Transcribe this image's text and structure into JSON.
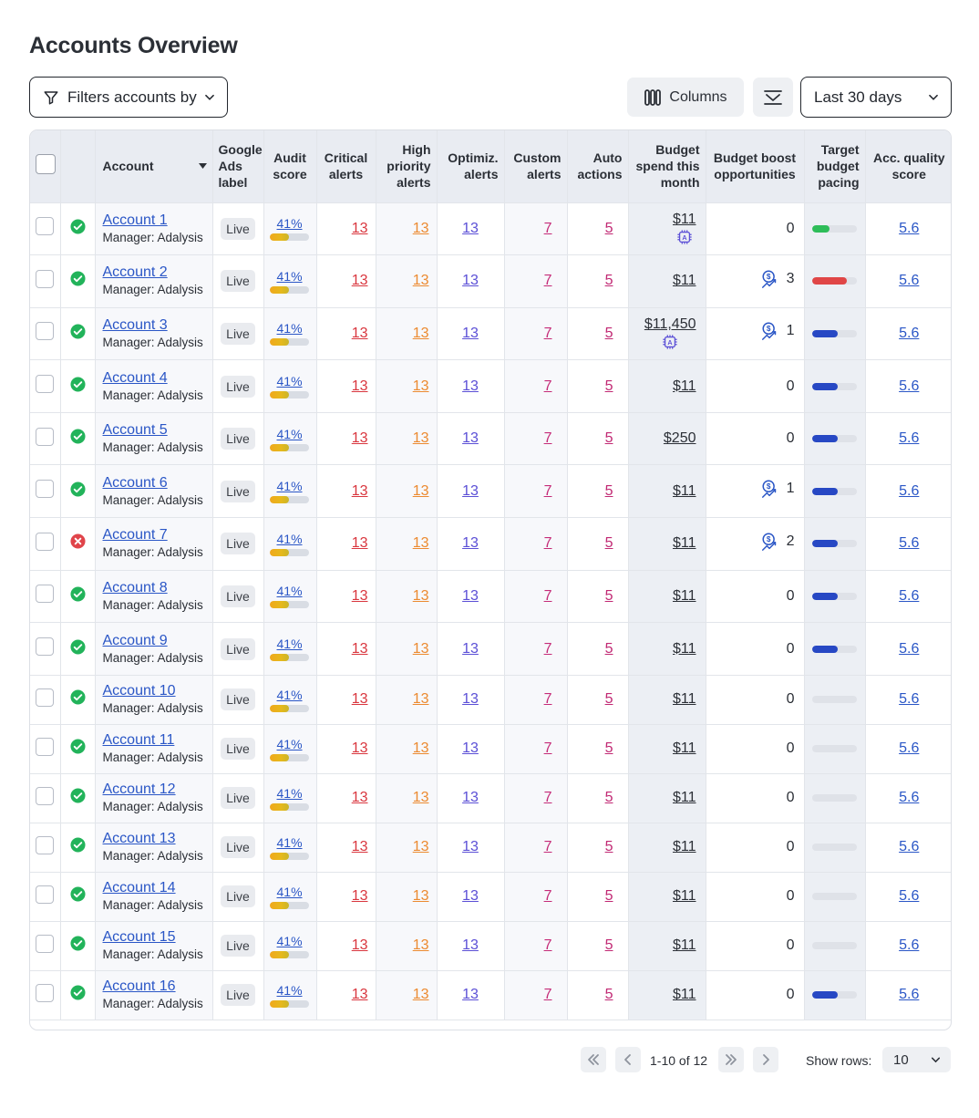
{
  "page": {
    "title": "Accounts Overview"
  },
  "toolbar": {
    "filter_label": "Filters accounts by",
    "columns_label": "Columns",
    "date_range": "Last 30 days"
  },
  "table": {
    "headers": {
      "account": "Account",
      "google_ads_label": "Google Ads label",
      "audit_score": "Audit score",
      "critical_alerts": "Critical alerts",
      "high_priority_alerts": "High priority alerts",
      "optimiz_alerts": "Optimiz. alerts",
      "custom_alerts": "Custom alerts",
      "auto_actions": "Auto actions",
      "budget_spend": "Budget spend this month",
      "budget_boost": "Budget boost opportunities",
      "target_pacing": "Target budget pacing",
      "quality_score": "Acc. quality score"
    },
    "rows": [
      {
        "status": "ok",
        "name": "Account 1",
        "manager": "Manager: Adalysis",
        "label": "Live",
        "audit": "41%",
        "audit_pct": 0.5,
        "critical": "13",
        "high": "13",
        "optimiz": "13",
        "custom": "7",
        "auto": "5",
        "spend": "$11",
        "ai_icon": true,
        "boost": "0",
        "boost_icon": false,
        "pacing_pct": 0.38,
        "pacing_color": "#2ebd59",
        "quality": "5.6"
      },
      {
        "status": "ok",
        "name": "Account 2",
        "manager": "Manager: Adalysis",
        "label": "Live",
        "audit": "41%",
        "audit_pct": 0.5,
        "critical": "13",
        "high": "13",
        "optimiz": "13",
        "custom": "7",
        "auto": "5",
        "spend": "$11",
        "ai_icon": false,
        "boost": "3",
        "boost_icon": true,
        "pacing_pct": 0.78,
        "pacing_color": "#e04646",
        "quality": "5.6"
      },
      {
        "status": "ok",
        "name": "Account 3",
        "manager": "Manager: Adalysis",
        "label": "Live",
        "audit": "41%",
        "audit_pct": 0.5,
        "critical": "13",
        "high": "13",
        "optimiz": "13",
        "custom": "7",
        "auto": "5",
        "spend": "$11,450",
        "ai_icon": true,
        "boost": "1",
        "boost_icon": true,
        "pacing_pct": 0.58,
        "pacing_color": "#2748c4",
        "quality": "5.6"
      },
      {
        "status": "ok",
        "name": "Account 4",
        "manager": "Manager: Adalysis",
        "label": "Live",
        "audit": "41%",
        "audit_pct": 0.5,
        "critical": "13",
        "high": "13",
        "optimiz": "13",
        "custom": "7",
        "auto": "5",
        "spend": "$11",
        "ai_icon": false,
        "boost": "0",
        "boost_icon": false,
        "pacing_pct": 0.58,
        "pacing_color": "#2748c4",
        "quality": "5.6"
      },
      {
        "status": "ok",
        "name": "Account 5",
        "manager": "Manager: Adalysis",
        "label": "Live",
        "audit": "41%",
        "audit_pct": 0.5,
        "critical": "13",
        "high": "13",
        "optimiz": "13",
        "custom": "7",
        "auto": "5",
        "spend": "$250",
        "ai_icon": false,
        "boost": "0",
        "boost_icon": false,
        "pacing_pct": 0.58,
        "pacing_color": "#2748c4",
        "quality": "5.6"
      },
      {
        "status": "ok",
        "name": "Account 6",
        "manager": "Manager: Adalysis",
        "label": "Live",
        "audit": "41%",
        "audit_pct": 0.5,
        "critical": "13",
        "high": "13",
        "optimiz": "13",
        "custom": "7",
        "auto": "5",
        "spend": "$11",
        "ai_icon": false,
        "boost": "1",
        "boost_icon": true,
        "pacing_pct": 0.58,
        "pacing_color": "#2748c4",
        "quality": "5.6"
      },
      {
        "status": "error",
        "name": "Account 7",
        "manager": "Manager: Adalysis",
        "label": "Live",
        "audit": "41%",
        "audit_pct": 0.5,
        "critical": "13",
        "high": "13",
        "optimiz": "13",
        "custom": "7",
        "auto": "5",
        "spend": "$11",
        "ai_icon": false,
        "boost": "2",
        "boost_icon": true,
        "pacing_pct": 0.58,
        "pacing_color": "#2748c4",
        "quality": "5.6"
      },
      {
        "status": "ok",
        "name": "Account 8",
        "manager": "Manager: Adalysis",
        "label": "Live",
        "audit": "41%",
        "audit_pct": 0.5,
        "critical": "13",
        "high": "13",
        "optimiz": "13",
        "custom": "7",
        "auto": "5",
        "spend": "$11",
        "ai_icon": false,
        "boost": "0",
        "boost_icon": false,
        "pacing_pct": 0.58,
        "pacing_color": "#2748c4",
        "quality": "5.6"
      },
      {
        "status": "ok",
        "name": "Account 9",
        "manager": "Manager: Adalysis",
        "label": "Live",
        "audit": "41%",
        "audit_pct": 0.5,
        "critical": "13",
        "high": "13",
        "optimiz": "13",
        "custom": "7",
        "auto": "5",
        "spend": "$11",
        "ai_icon": false,
        "boost": "0",
        "boost_icon": false,
        "pacing_pct": 0.58,
        "pacing_color": "#2748c4",
        "quality": "5.6"
      },
      {
        "status": "ok",
        "name": "Account 10",
        "manager": "Manager: Adalysis",
        "label": "Live",
        "audit": "41%",
        "audit_pct": 0.5,
        "critical": "13",
        "high": "13",
        "optimiz": "13",
        "custom": "7",
        "auto": "5",
        "spend": "$11",
        "ai_icon": false,
        "boost": "0",
        "boost_icon": false,
        "pacing_pct": 0,
        "pacing_color": "#2748c4",
        "quality": "5.6"
      },
      {
        "status": "ok",
        "name": "Account 11",
        "manager": "Manager: Adalysis",
        "label": "Live",
        "audit": "41%",
        "audit_pct": 0.5,
        "critical": "13",
        "high": "13",
        "optimiz": "13",
        "custom": "7",
        "auto": "5",
        "spend": "$11",
        "ai_icon": false,
        "boost": "0",
        "boost_icon": false,
        "pacing_pct": 0,
        "pacing_color": "#2748c4",
        "quality": "5.6"
      },
      {
        "status": "ok",
        "name": "Account 12",
        "manager": "Manager: Adalysis",
        "label": "Live",
        "audit": "41%",
        "audit_pct": 0.5,
        "critical": "13",
        "high": "13",
        "optimiz": "13",
        "custom": "7",
        "auto": "5",
        "spend": "$11",
        "ai_icon": false,
        "boost": "0",
        "boost_icon": false,
        "pacing_pct": 0,
        "pacing_color": "#2748c4",
        "quality": "5.6"
      },
      {
        "status": "ok",
        "name": "Account 13",
        "manager": "Manager: Adalysis",
        "label": "Live",
        "audit": "41%",
        "audit_pct": 0.5,
        "critical": "13",
        "high": "13",
        "optimiz": "13",
        "custom": "7",
        "auto": "5",
        "spend": "$11",
        "ai_icon": false,
        "boost": "0",
        "boost_icon": false,
        "pacing_pct": 0,
        "pacing_color": "#2748c4",
        "quality": "5.6"
      },
      {
        "status": "ok",
        "name": "Account 14",
        "manager": "Manager: Adalysis",
        "label": "Live",
        "audit": "41%",
        "audit_pct": 0.5,
        "critical": "13",
        "high": "13",
        "optimiz": "13",
        "custom": "7",
        "auto": "5",
        "spend": "$11",
        "ai_icon": false,
        "boost": "0",
        "boost_icon": false,
        "pacing_pct": 0,
        "pacing_color": "#2748c4",
        "quality": "5.6"
      },
      {
        "status": "ok",
        "name": "Account 15",
        "manager": "Manager: Adalysis",
        "label": "Live",
        "audit": "41%",
        "audit_pct": 0.5,
        "critical": "13",
        "high": "13",
        "optimiz": "13",
        "custom": "7",
        "auto": "5",
        "spend": "$11",
        "ai_icon": false,
        "boost": "0",
        "boost_icon": false,
        "pacing_pct": 0,
        "pacing_color": "#2748c4",
        "quality": "5.6"
      },
      {
        "status": "ok",
        "name": "Account 16",
        "manager": "Manager: Adalysis",
        "label": "Live",
        "audit": "41%",
        "audit_pct": 0.5,
        "critical": "13",
        "high": "13",
        "optimiz": "13",
        "custom": "7",
        "auto": "5",
        "spend": "$11",
        "ai_icon": false,
        "boost": "0",
        "boost_icon": false,
        "pacing_pct": 0.58,
        "pacing_color": "#2748c4",
        "quality": "5.6"
      }
    ]
  },
  "pagination": {
    "info": "1-10 of 12",
    "show_rows_label": "Show rows:",
    "rows_value": "10"
  },
  "colors": {
    "status_ok": "#22b35a",
    "status_error": "#e0444a",
    "link": "#2a56c6"
  }
}
